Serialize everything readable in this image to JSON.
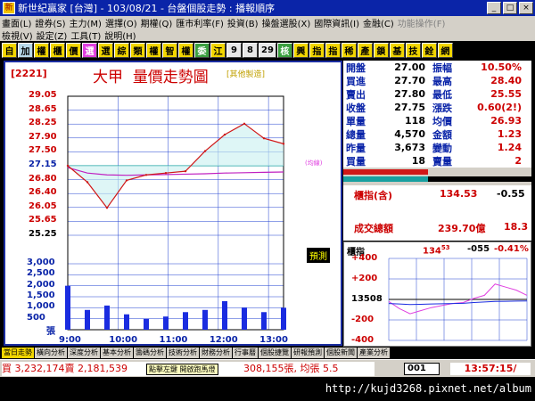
{
  "window": {
    "title": "新世紀贏家 [台灣] - 103/08/21 - 台盤個股走勢 : 播報順序",
    "minimize": "_",
    "maximize": "□",
    "close": "×"
  },
  "menu": {
    "row1": [
      "畫面(L)",
      "證券(S)",
      "主力(M)",
      "選擇(O)",
      "期權(Q)",
      "匯市利率(F)",
      "投資(B)",
      "操盤選股(X)",
      "國際資訊(I)",
      "金融(C)",
      "功能操作(F)"
    ],
    "row2": [
      "檢視(V)",
      "設定(Z)",
      "工具(T)",
      "說明(H)"
    ]
  },
  "toolbar": [
    "自",
    "加",
    "權",
    "櫃",
    "價",
    "選",
    "選",
    "綜",
    "類",
    "權",
    "智",
    "權",
    "委",
    "江",
    "9",
    "8",
    "29",
    "核",
    "興",
    "指",
    "指",
    "稀",
    "產",
    "鎖",
    "基",
    "技",
    "銓",
    "網"
  ],
  "chart": {
    "ticker": "[2221]",
    "name": "大甲",
    "title": "量價走勢圖",
    "note": "[其他製造]",
    "ma_label": "(均線)",
    "volume_label": "張",
    "yupiao_label": "預測",
    "price_ticks": [
      "29.05",
      "28.65",
      "28.25",
      "27.90",
      "27.50",
      "27.15",
      "26.80",
      "26.40",
      "26.05",
      "25.65",
      "25.25"
    ],
    "volume_ticks": [
      "3,000",
      "2,500",
      "2,000",
      "1,500",
      "1,000",
      "500",
      "張"
    ],
    "time_ticks": [
      "9:00",
      "10:00",
      "11:00",
      "12:00",
      "13:00"
    ]
  },
  "chart_data": {
    "type": "line",
    "x": [
      "9:00",
      "9:30",
      "10:00",
      "10:30",
      "11:00",
      "11:30",
      "12:00",
      "12:30",
      "13:00",
      "13:10",
      "13:20",
      "13:30"
    ],
    "series": [
      {
        "name": "price",
        "values": [
          27.15,
          26.7,
          26.0,
          26.75,
          26.9,
          26.95,
          27.0,
          27.55,
          28.0,
          28.3,
          27.9,
          27.75
        ]
      },
      {
        "name": "avg",
        "values": [
          27.1,
          26.95,
          26.9,
          26.89,
          26.9,
          26.91,
          26.92,
          26.93,
          26.95,
          26.96,
          26.97,
          26.98
        ]
      },
      {
        "name": "volume",
        "values": [
          2000,
          900,
          1100,
          700,
          500,
          600,
          800,
          900,
          1300,
          1000,
          800,
          1000
        ]
      }
    ],
    "ylim": [
      25.25,
      29.05
    ],
    "y2lim": [
      0,
      3000
    ],
    "grid": true,
    "colors": {
      "price": "#d01818",
      "avg": "#c020c0",
      "volume": "#1a2ce0",
      "ref": "#18a0a0",
      "grid": "#2040d0"
    }
  },
  "stats": [
    {
      "l1": "開盤",
      "v1": "27.00",
      "l2": "振幅",
      "v2": "10.50%"
    },
    {
      "l1": "買進",
      "v1": "27.70",
      "l2": "最高",
      "v2": "28.40"
    },
    {
      "l1": "賣出",
      "v1": "27.80",
      "l2": "最低",
      "v2": "25.55"
    },
    {
      "l1": "收盤",
      "v1": "27.75",
      "l2": "漲跌",
      "v2": "0.60(2!)"
    },
    {
      "l1": "單量",
      "v1": "118",
      "l2": "均價",
      "v2": "26.93"
    },
    {
      "l1": "總量",
      "v1": "4,570",
      "l2": "金額",
      "v2": "1.23"
    },
    {
      "l1": "昨量",
      "v1": "3,673",
      "l2": "變動",
      "v2": "1.24"
    },
    {
      "l1": "買量",
      "v1": "18",
      "l2": "賣量",
      "v2": "2"
    }
  ],
  "bars": {
    "buy_fraction": 0.45,
    "sell_fraction": 0.55
  },
  "index": {
    "label": "櫃指(含)",
    "value": "134.53",
    "change": "-0.55",
    "total_label": "成交總額",
    "total": "239.70億",
    "total2": "18.3"
  },
  "mini": {
    "label": "櫃指",
    "value": "134",
    "value_sub": "53",
    "change": "-055",
    "pct": "-0.41%",
    "ticks": [
      "+400",
      "+200",
      "13508",
      "-200",
      "-400"
    ]
  },
  "tabs": [
    "當日走勢",
    "橫向分析",
    "深度分析",
    "基本分析",
    "籌碼分析",
    "技術分析",
    "財務分析",
    "行事曆",
    "個股捷覽",
    "研報預測",
    "個股新聞",
    "產業分析"
  ],
  "status": {
    "ticker_text": "買 3,232,174賣 2,181,539",
    "ticker_text2": "308,155張, 均張 5.5",
    "hint": "點擊左鍵 開啟跑馬燈",
    "page": "001",
    "clock": "13:57:15/"
  },
  "footer": "http://kujd3268.pixnet.net/album"
}
